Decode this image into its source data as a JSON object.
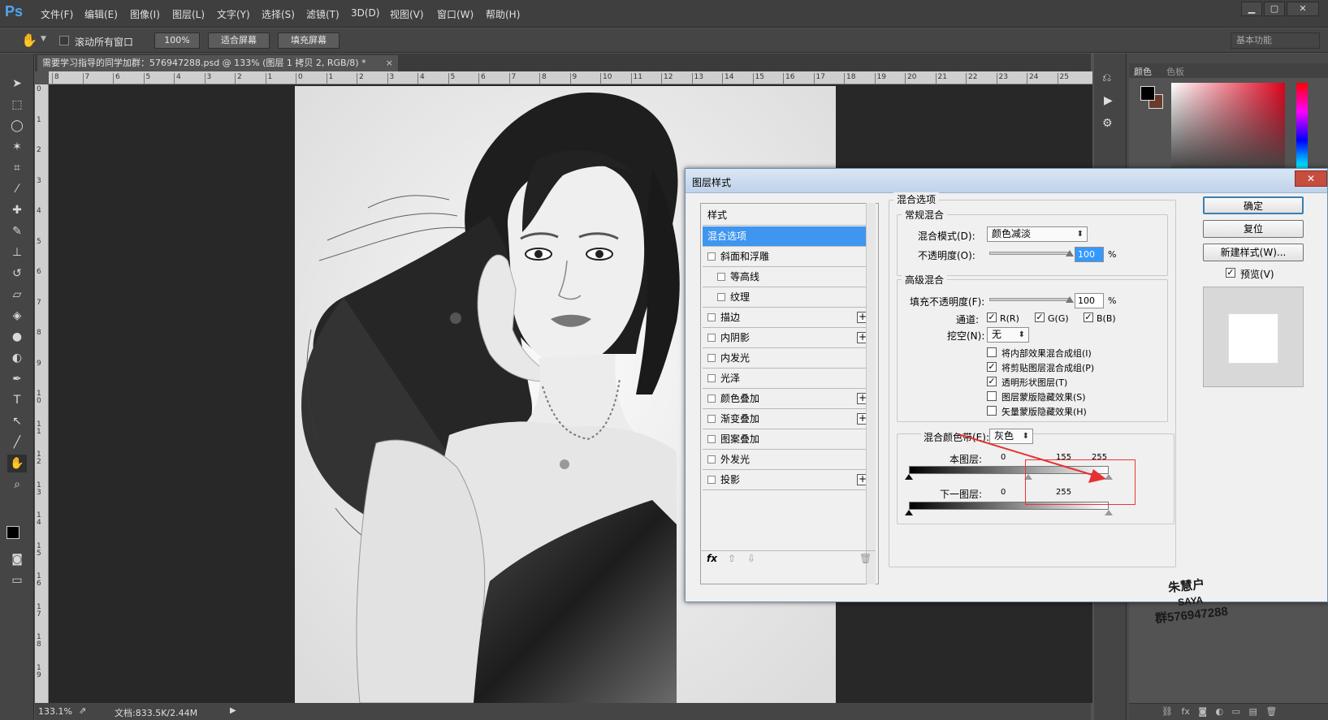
{
  "app": {
    "logo": "Ps"
  },
  "menu": [
    "文件(F)",
    "编辑(E)",
    "图像(I)",
    "图层(L)",
    "文字(Y)",
    "选择(S)",
    "滤镜(T)",
    "3D(D)",
    "视图(V)",
    "窗口(W)",
    "帮助(H)"
  ],
  "window_controls": {
    "minimize": "▁",
    "maximize": "▢",
    "close": "✕"
  },
  "options": {
    "scroll_all_label": "滚动所有窗口",
    "zoom_btn": "100%",
    "fit_btn": "适合屏幕",
    "fill_btn": "填充屏幕",
    "workspace": "基本功能"
  },
  "document": {
    "tab_title": "需要学习指导的同学加群：576947288.psd @ 133% (图层 1 拷贝 2, RGB/8) *",
    "tab_close": "×",
    "hruler_labels": [
      "8",
      "7",
      "6",
      "5",
      "4",
      "3",
      "2",
      "1",
      "0",
      "1",
      "2",
      "3",
      "4",
      "5",
      "6",
      "7",
      "8",
      "9",
      "10",
      "11",
      "12",
      "13",
      "14",
      "15",
      "16",
      "17",
      "18",
      "19",
      "20",
      "21",
      "22",
      "23",
      "24",
      "25"
    ],
    "vruler_labels": [
      "0",
      "1",
      "2",
      "3",
      "4",
      "5",
      "6",
      "7",
      "8",
      "9",
      "1\n0",
      "1\n1",
      "1\n2",
      "1\n3",
      "1\n4",
      "1\n5",
      "1\n6",
      "1\n7",
      "1\n8",
      "1\n9"
    ]
  },
  "status": {
    "zoom": "133.1%",
    "docsize": "文档:833.5K/2.44M"
  },
  "panels": {
    "color_tab": "颜色",
    "swatches_tab": "色板"
  },
  "dialog": {
    "title": "图层样式",
    "close": "✕",
    "styles_header": "样式",
    "items": [
      {
        "label": "混合选项",
        "checkbox": false,
        "plus": false,
        "selected": true,
        "indent": false
      },
      {
        "label": "斜面和浮雕",
        "checkbox": true,
        "plus": false,
        "selected": false,
        "indent": false
      },
      {
        "label": "等高线",
        "checkbox": true,
        "plus": false,
        "selected": false,
        "indent": true
      },
      {
        "label": "纹理",
        "checkbox": true,
        "plus": false,
        "selected": false,
        "indent": true
      },
      {
        "label": "描边",
        "checkbox": true,
        "plus": true,
        "selected": false,
        "indent": false
      },
      {
        "label": "内阴影",
        "checkbox": true,
        "plus": true,
        "selected": false,
        "indent": false
      },
      {
        "label": "内发光",
        "checkbox": true,
        "plus": false,
        "selected": false,
        "indent": false
      },
      {
        "label": "光泽",
        "checkbox": true,
        "plus": false,
        "selected": false,
        "indent": false
      },
      {
        "label": "颜色叠加",
        "checkbox": true,
        "plus": true,
        "selected": false,
        "indent": false
      },
      {
        "label": "渐变叠加",
        "checkbox": true,
        "plus": true,
        "selected": false,
        "indent": false
      },
      {
        "label": "图案叠加",
        "checkbox": true,
        "plus": false,
        "selected": false,
        "indent": false
      },
      {
        "label": "外发光",
        "checkbox": true,
        "plus": false,
        "selected": false,
        "indent": false
      },
      {
        "label": "投影",
        "checkbox": true,
        "plus": true,
        "selected": false,
        "indent": false
      }
    ],
    "fx_label": "fx",
    "blend_options": {
      "section": "混合选项",
      "general": "常规混合",
      "blend_mode_label": "混合模式(D):",
      "blend_mode": "颜色减淡",
      "opacity_label": "不透明度(O):",
      "opacity": "100",
      "percent": "%",
      "advanced": "高级混合",
      "fill_label": "填充不透明度(F):",
      "fill": "100",
      "channels_label": "通道:",
      "ch_r": "R(R)",
      "ch_g": "G(G)",
      "ch_b": "B(B)",
      "knockout_label": "挖空(N):",
      "knockout": "无",
      "opt1": "将内部效果混合成组(I)",
      "opt2": "将剪贴图层混合成组(P)",
      "opt3": "透明形状图层(T)",
      "opt4": "图层蒙版隐藏效果(S)",
      "opt5": "矢量蒙版隐藏效果(H)",
      "blend_if_label": "混合颜色带(E):",
      "blend_if": "灰色",
      "this_layer_label": "本图层:",
      "this_layer_min": "0",
      "this_layer_split": "155",
      "this_layer_max": "255",
      "underlying_label": "下一图层:",
      "under_min": "0",
      "under_max": "255"
    },
    "checks": {
      "opt1": false,
      "opt2": true,
      "opt3": true,
      "opt4": false,
      "opt5": false,
      "r": true,
      "g": true,
      "b": true,
      "preview": true
    },
    "buttons": {
      "ok": "确定",
      "reset": "复位",
      "new_style": "新建样式(W)...",
      "preview": "预览(V)"
    }
  },
  "watermark": [
    "朱慧户",
    "SAYA",
    "群576947288"
  ]
}
